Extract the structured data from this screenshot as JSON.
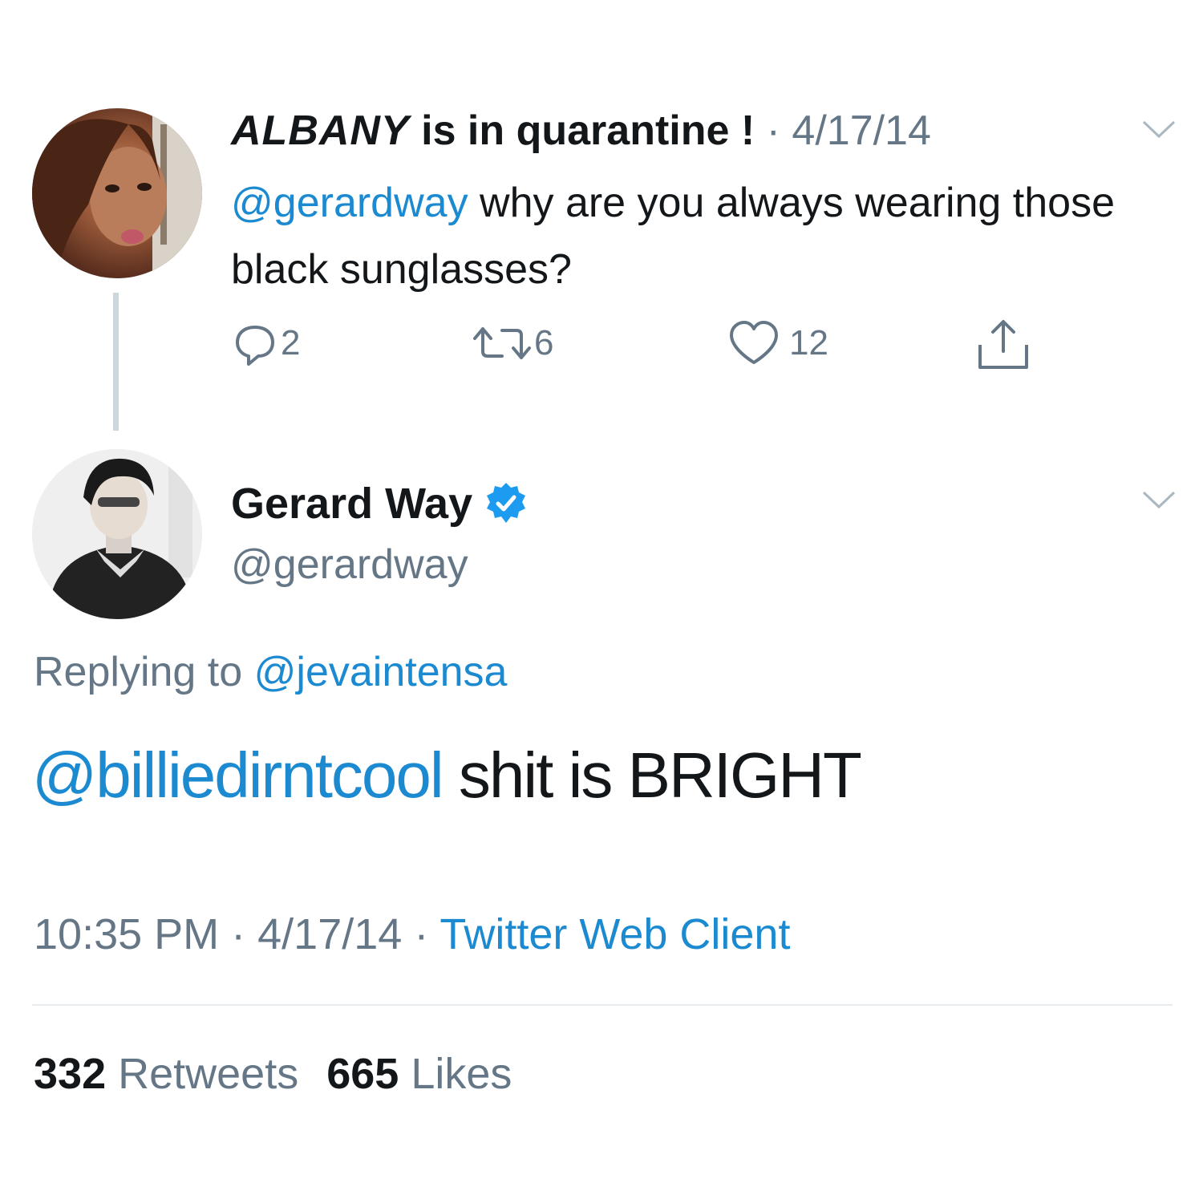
{
  "colors": {
    "link_blue": "#1b8ad0",
    "secondary_grey": "#657786",
    "verified_blue": "#1d9bf0",
    "text_dark": "#14171a"
  },
  "parent_tweet": {
    "display_name_styled": "ALBANY",
    "display_name_rest": " is in quarantine !",
    "separator": "·",
    "date": "4/17/14",
    "mention": "@gerardway",
    "text": " why are you always wearing those black sunglasses?",
    "actions": {
      "reply_count": "2",
      "retweet_count": "6",
      "like_count": "12"
    },
    "icons": [
      "chevron-down-icon",
      "reply-icon",
      "retweet-icon",
      "like-icon",
      "share-icon"
    ]
  },
  "main_tweet": {
    "display_name": "Gerard Way",
    "handle": "@gerardway",
    "replying_prefix": "Replying to ",
    "replying_handle": "@jevaintensa",
    "mention": "@billiedirntcool",
    "text": " shit is BRIGHT",
    "time": "10:35 PM",
    "sep1": " · ",
    "date": "4/17/14",
    "sep2": " · ",
    "client": "Twitter Web Client",
    "retweets_count": "332",
    "retweets_label": " Retweets",
    "likes_count": "665",
    "likes_label": " Likes",
    "icons": [
      "verified-badge-icon",
      "chevron-down-icon"
    ]
  }
}
